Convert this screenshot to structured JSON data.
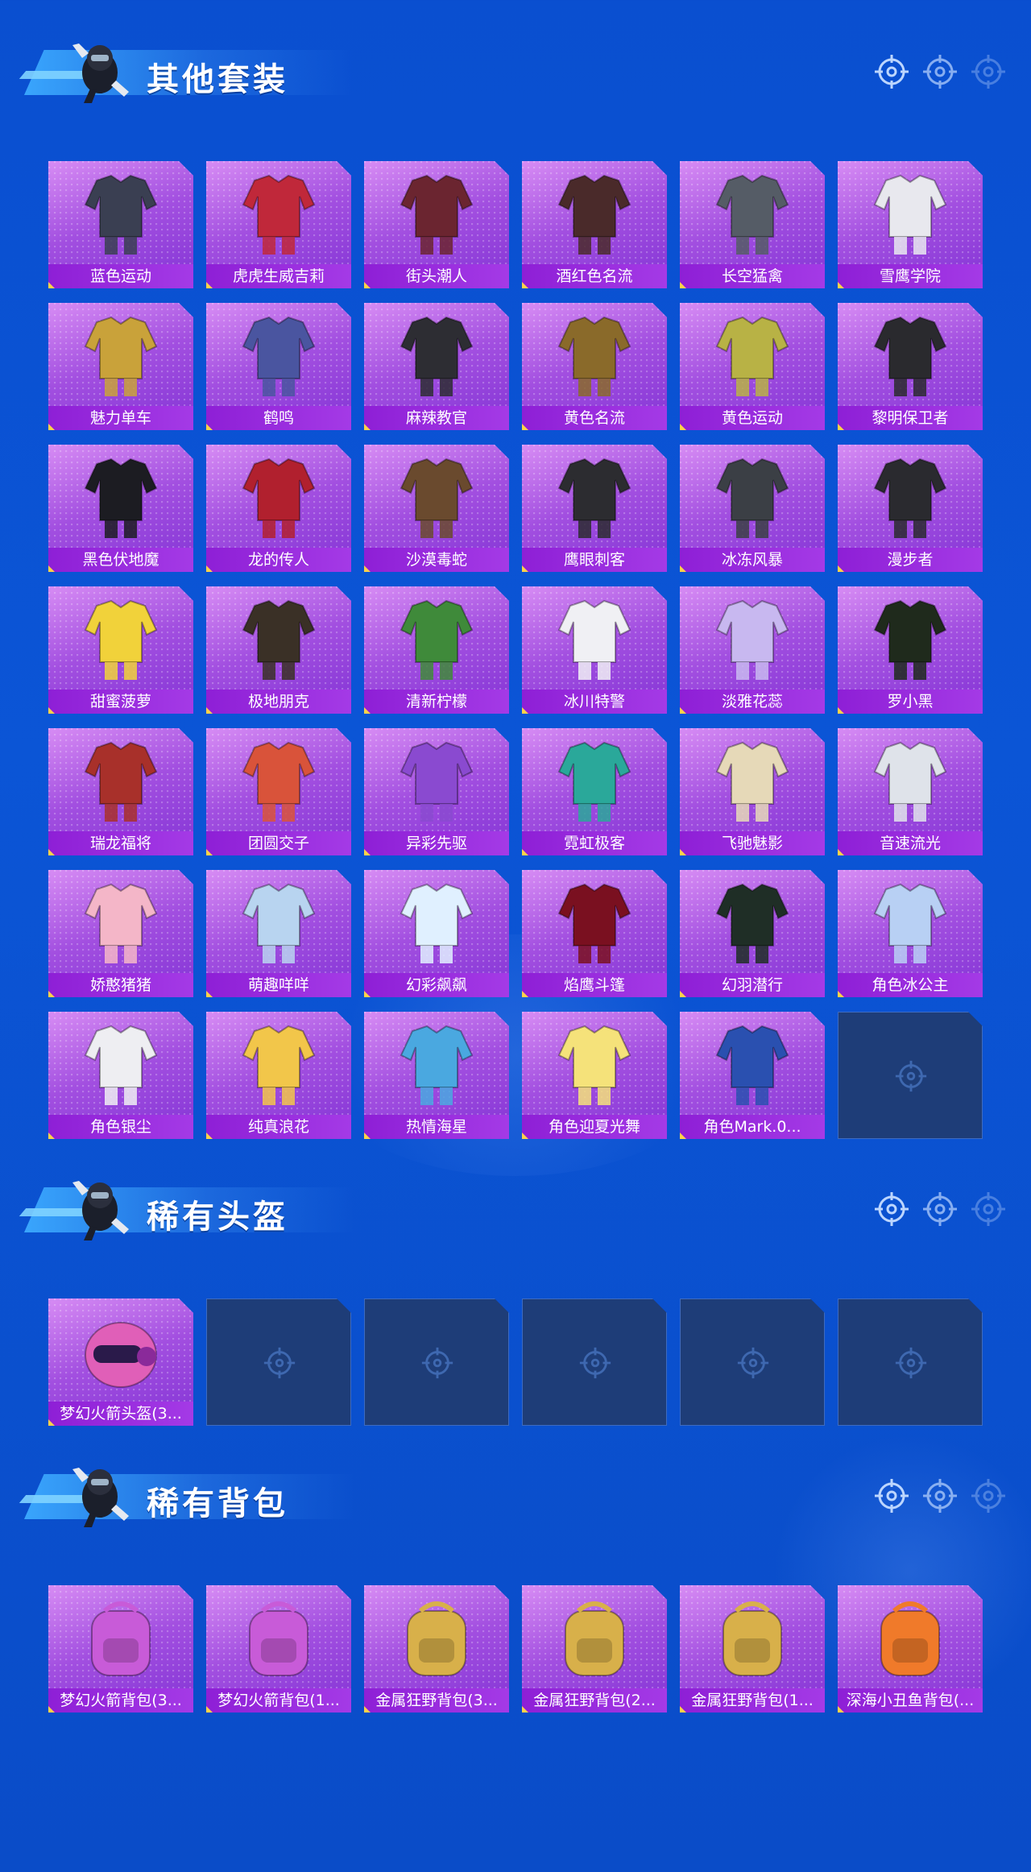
{
  "colors": {
    "background": "#0a4fd0",
    "card_purple": "#a24fe0",
    "label_bar": "#8e1fd6",
    "empty_slot": "#1e3d78"
  },
  "sections": [
    {
      "title": "其他套装",
      "items": [
        "蓝色运动",
        "虎虎生威吉莉",
        "街头潮人",
        "酒红色名流",
        "长空猛禽",
        "雪鹰学院",
        "魅力单车",
        "鹤鸣",
        "麻辣教官",
        "黄色名流",
        "黄色运动",
        "黎明保卫者",
        "黑色伏地魔",
        "龙的传人",
        "沙漠毒蛇",
        "鹰眼刺客",
        "冰冻风暴",
        "漫步者",
        "甜蜜菠萝",
        "极地朋克",
        "清新柠檬",
        "冰川特警",
        "淡雅花蕊",
        "罗小黑",
        "瑞龙福将",
        "团圆交子",
        "异彩先驱",
        "霓虹极客",
        "飞驰魅影",
        "音速流光",
        "娇憨猪猪",
        "萌趣咩咩",
        "幻彩飙飙",
        "焰鹰斗篷",
        "幻羽潜行",
        "角色冰公主",
        "角色银尘",
        "纯真浪花",
        "热情海星",
        "角色迎夏光舞",
        "角色Mark.0..."
      ],
      "empty_slots": 1
    },
    {
      "title": "稀有头盔",
      "items": [
        "梦幻火箭头盔(3..."
      ],
      "empty_slots": 5
    },
    {
      "title": "稀有背包",
      "items": [
        "梦幻火箭背包(3...",
        "梦幻火箭背包(1...",
        "金属狂野背包(3...",
        "金属狂野背包(2...",
        "金属狂野背包(1...",
        "深海小丑鱼背包(..."
      ],
      "empty_slots": 0
    }
  ],
  "icons": {
    "header_mascot": "mascot-icon",
    "header_targets": "crosshair-icon",
    "empty_slot": "crosshair-icon"
  }
}
